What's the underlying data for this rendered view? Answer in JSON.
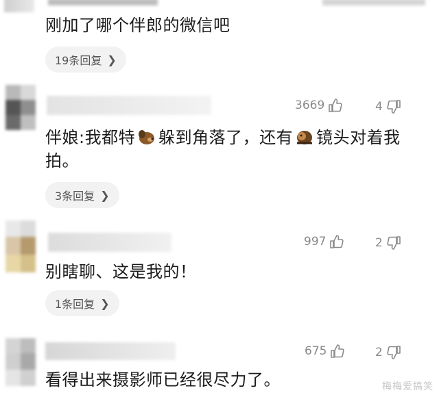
{
  "comments": [
    {
      "text": "刚加了哪个伴郎的微信吧",
      "replies": "19条回复"
    },
    {
      "likes": "3669",
      "dislikes": "4",
      "text_part1": "伴娘:我都特",
      "text_part2": "躲到角落了，还有",
      "text_part3": "镜头对着我",
      "text_part4": "拍。",
      "replies": "3条回复"
    },
    {
      "likes": "997",
      "dislikes": "2",
      "text": "别瞎聊、这是我的！",
      "replies": "1条回复"
    },
    {
      "likes": "675",
      "dislikes": "2",
      "text": "看得出来摄影师已经很尽力了。"
    }
  ],
  "icons": {
    "like": "thumbs-up-icon",
    "dislike": "thumbs-down-icon",
    "emoji1": "dog-emoji",
    "emoji2": "dog-emoji",
    "chevron": "chevron-right-icon"
  },
  "watermark": "梅梅爱搞笑"
}
